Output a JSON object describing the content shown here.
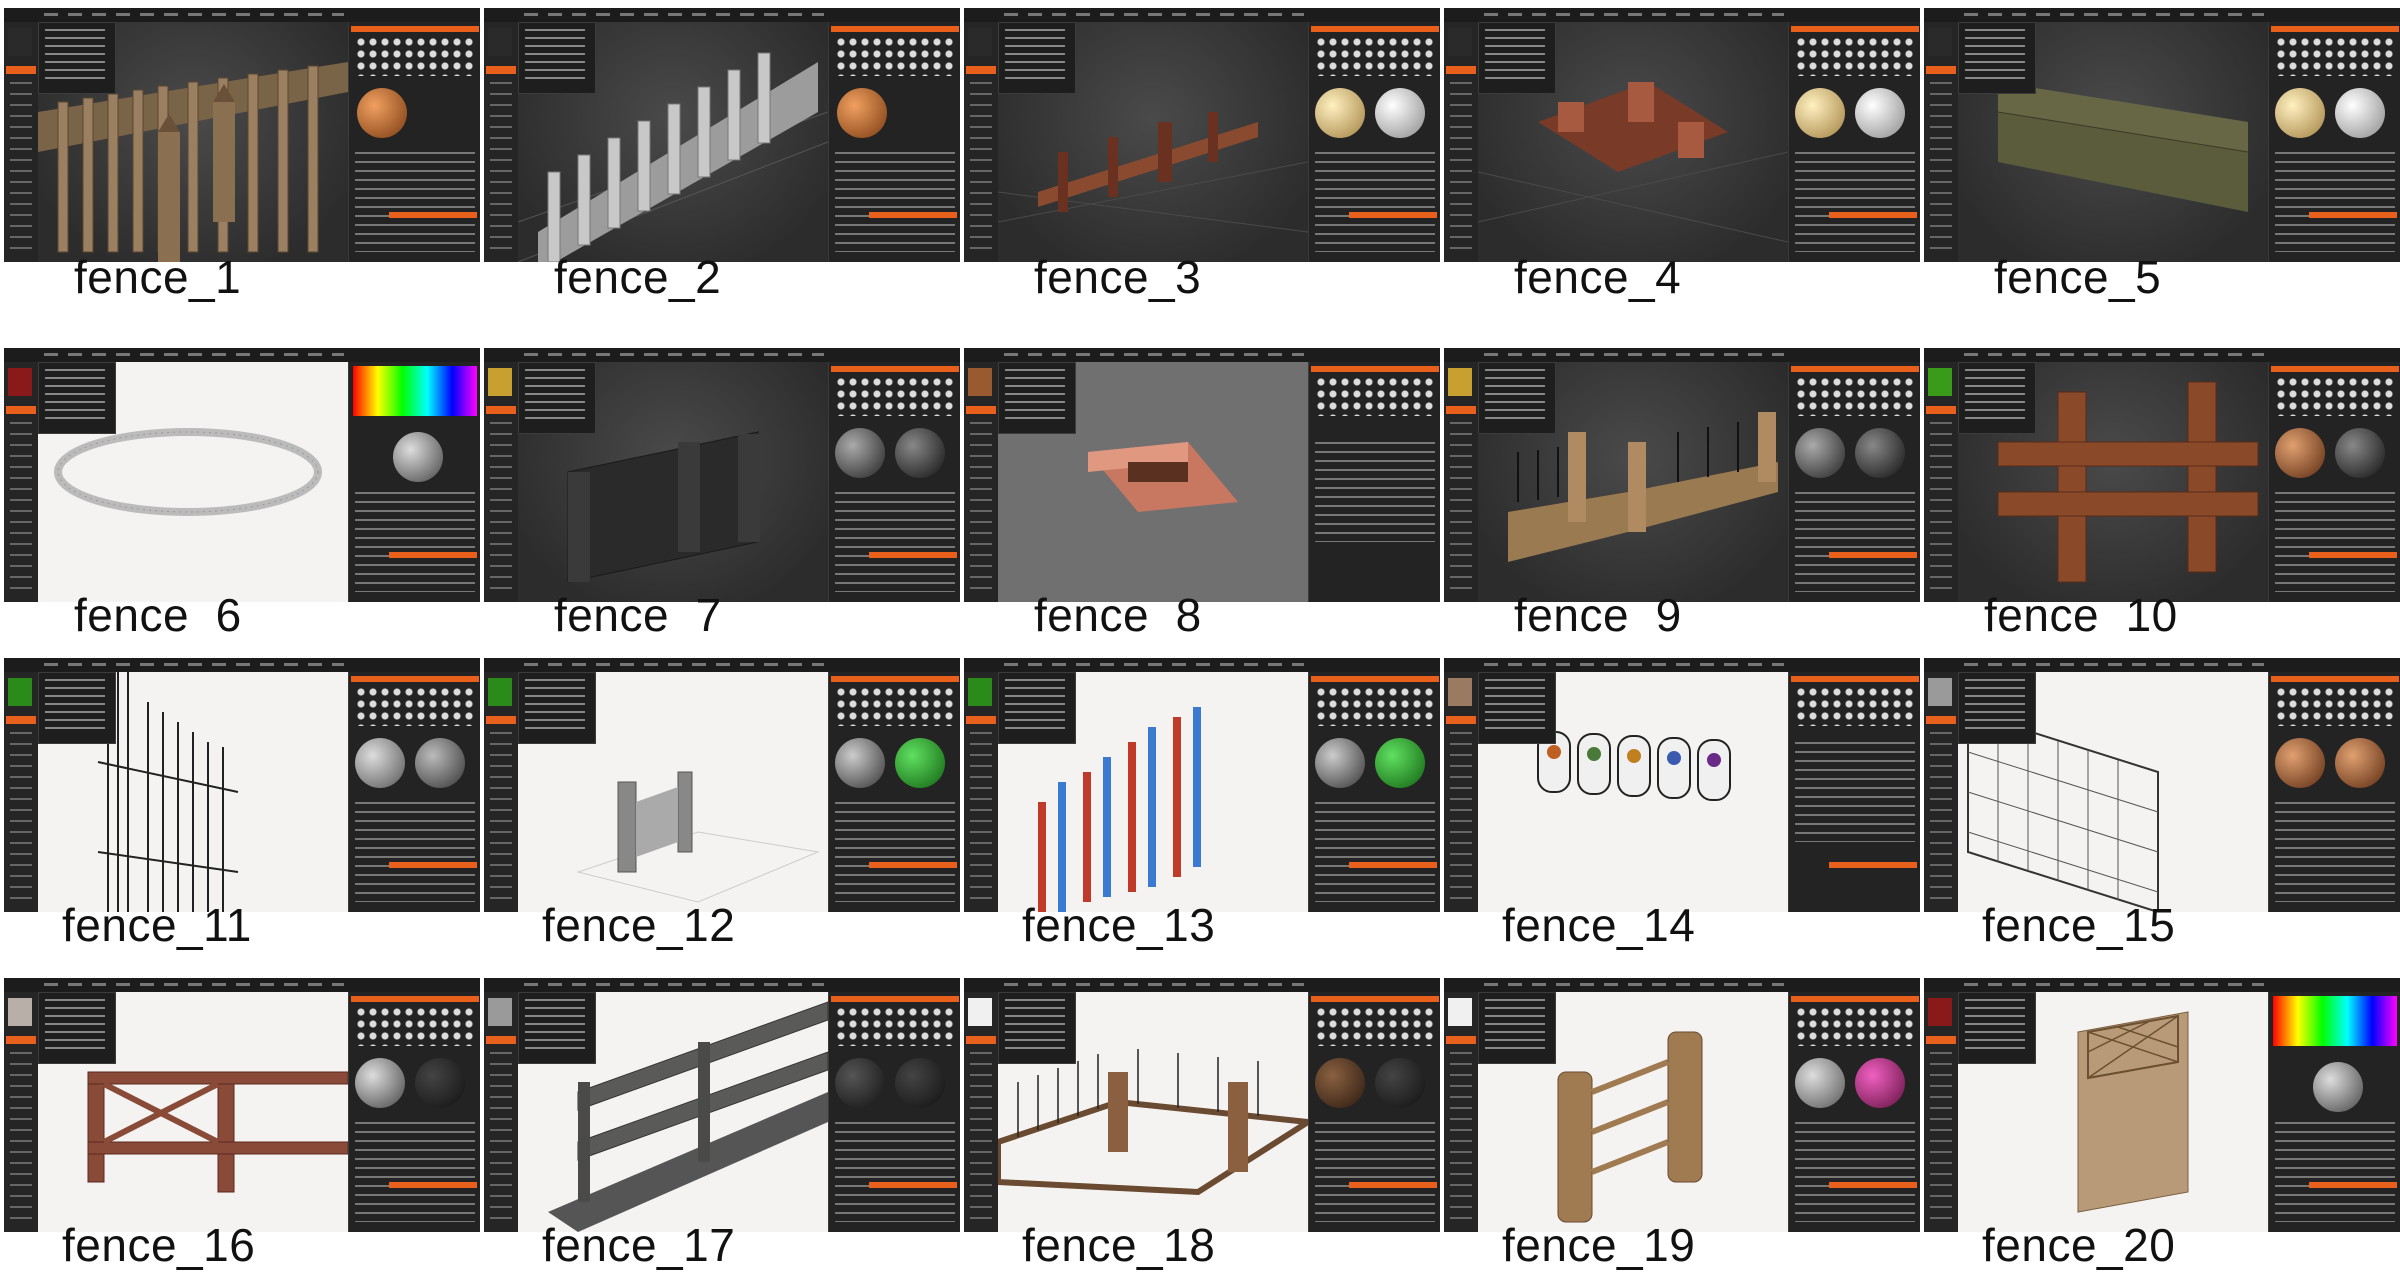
{
  "items": [
    {
      "label": "fence_1"
    },
    {
      "label": "fence_2"
    },
    {
      "label": "fence_3"
    },
    {
      "label": "fence_4"
    },
    {
      "label": "fence_5"
    },
    {
      "label": "fence  6"
    },
    {
      "label": "fence  7"
    },
    {
      "label": "fence  8"
    },
    {
      "label": "fence  9"
    },
    {
      "label": "fence  10"
    },
    {
      "label": "fence_11"
    },
    {
      "label": "fence_12"
    },
    {
      "label": "fence_13"
    },
    {
      "label": "fence_14"
    },
    {
      "label": "fence_15"
    },
    {
      "label": "fence_16"
    },
    {
      "label": "fence_17"
    },
    {
      "label": "fence_18"
    },
    {
      "label": "fence_19"
    },
    {
      "label": "fence_20"
    }
  ],
  "colors": {
    "accent": "#e8601c",
    "panel": "#232323",
    "toolbar": "#1c1c1c",
    "viewport_dark": "#2c2c2c",
    "viewport_light": "#f4f3f1"
  }
}
